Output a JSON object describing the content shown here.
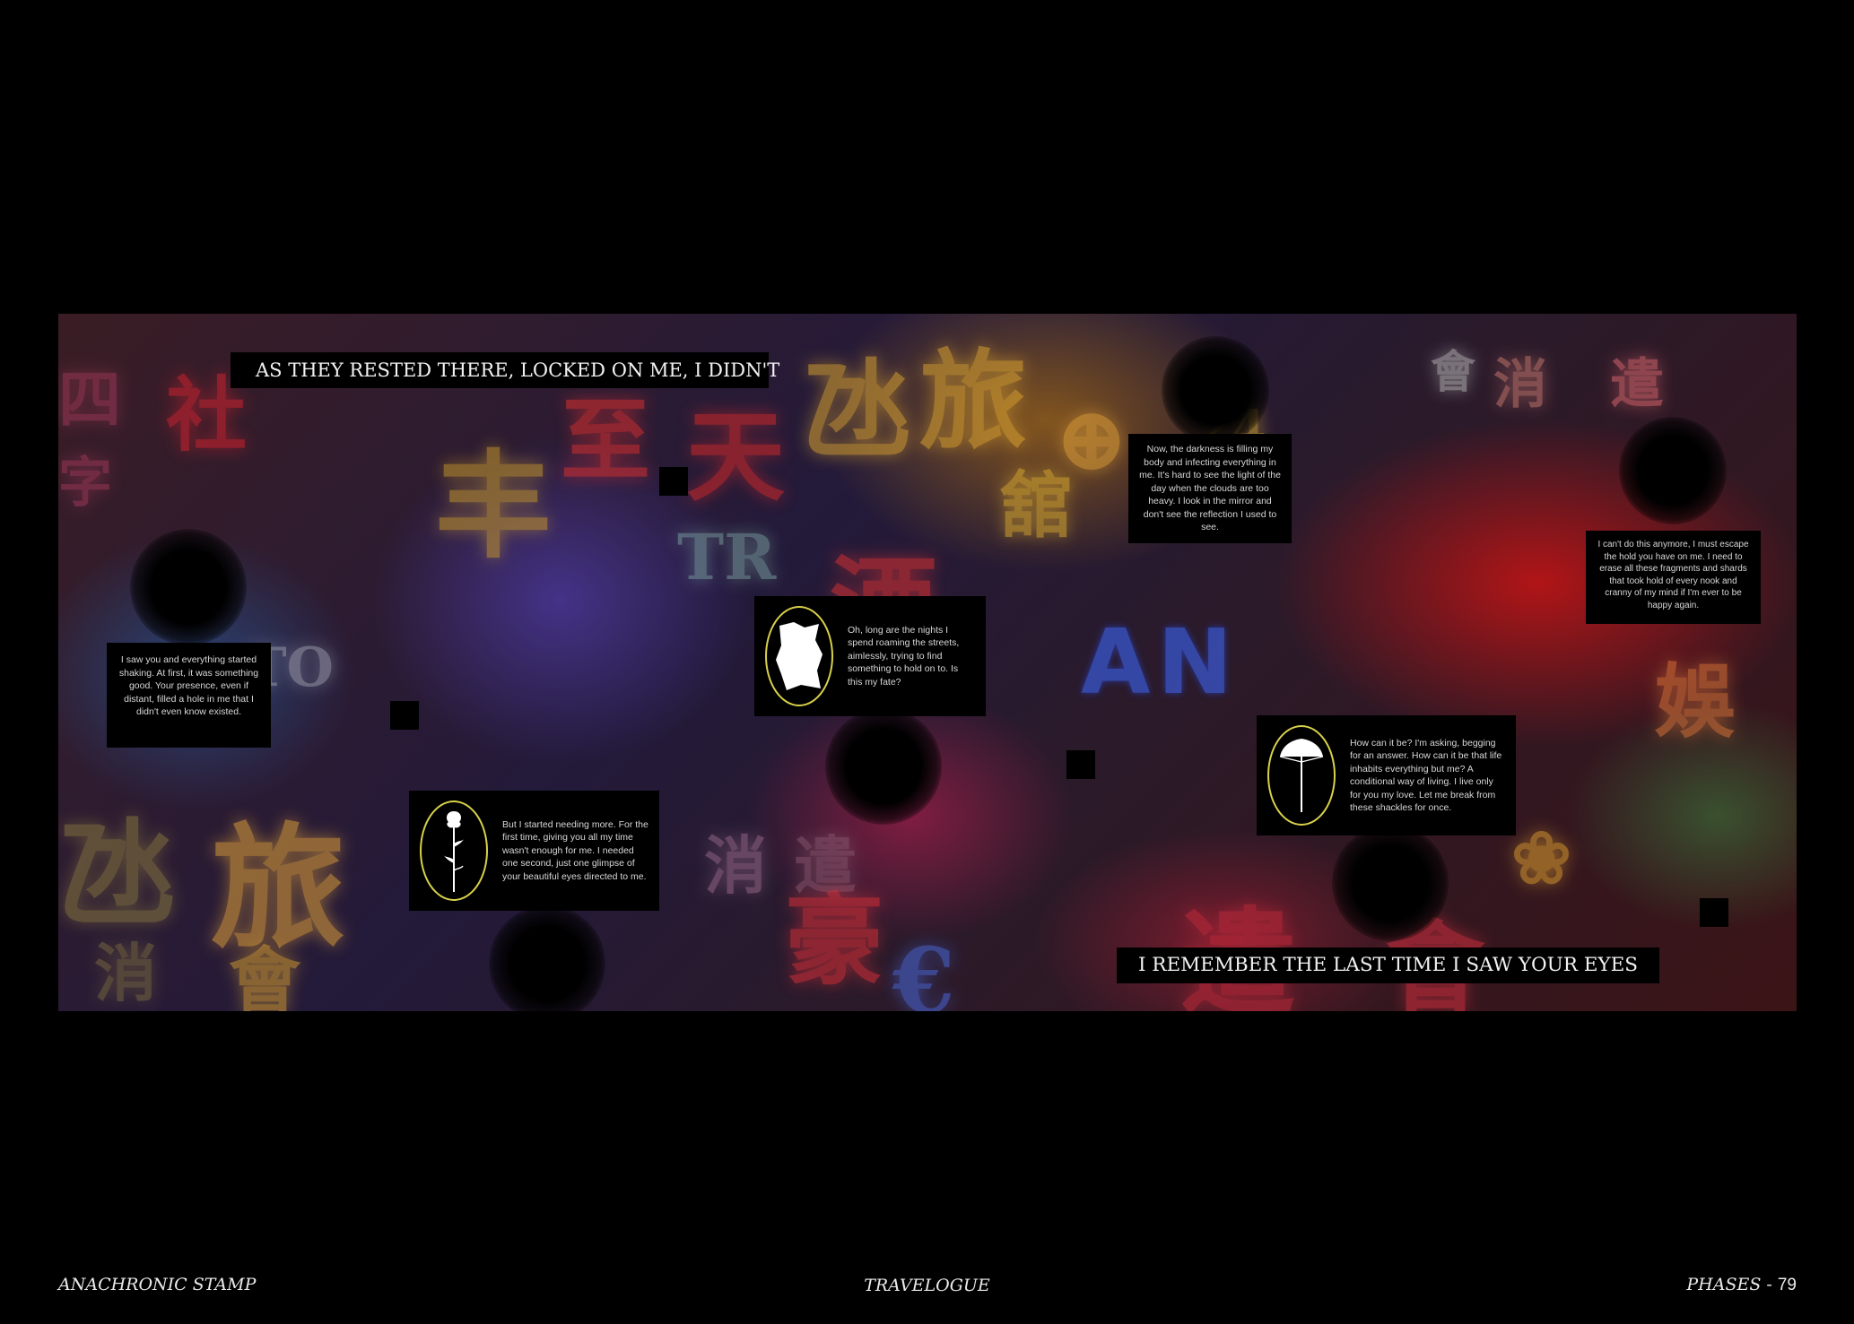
{
  "scene": {
    "banner_top": "As they rested there, locked on me, I didn't",
    "banner_bottom": "I remember the last time I saw your eyes",
    "text_left": "I saw you and everything started shaking. At first, it was something good. Your presence, even if distant, filled a hole in me that I didn't even know existed.",
    "text_top_right": "Now, the darkness is filling my body and infecting everything in me. It's hard to see the light of the day when the clouds are too heavy. I look in the mirror and don't see the reflection I used to see.",
    "text_far_right": "I can't do this anymore, I must escape the hold you have on me. I need to erase all these fragments and shards that took hold of every nook and cranny of my mind if I'm ever to be happy again.",
    "card_rose": "But I started needing more. For the first time, giving you all my time wasn't enough for me. I needed one second, just one glimpse of your beautiful eyes directed to me.",
    "card_paper": "Oh, long are the nights I spend roaming the streets, aimlessly, trying to find something to hold on to. Is this my fate?",
    "card_umbrella": "How can it be? I'm asking, begging for an answer. How can it be that life inhabits everything but me? A conditional way of living. I live only for you my love. Let me break from these shackles for once.",
    "icons": [
      "rose-icon",
      "crumpled-paper-icon",
      "umbrella-icon"
    ],
    "accent_color": "#d9d24a"
  },
  "footer": {
    "left": "ANACHRONIC STAMP",
    "center": "TRAVELOGUE",
    "right_label": "PHASES",
    "right_sep": " - ",
    "page_number": "79"
  }
}
